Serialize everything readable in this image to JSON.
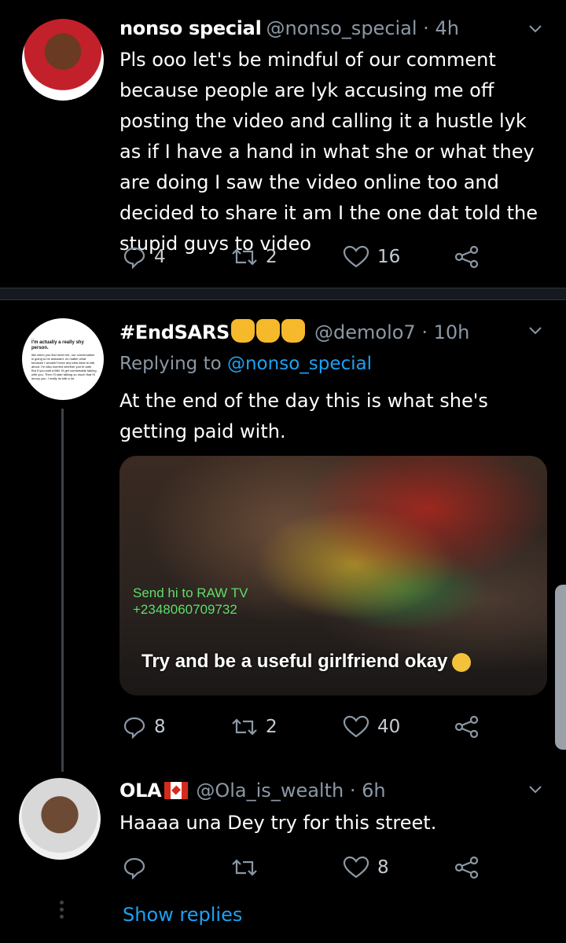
{
  "tweets": [
    {
      "name": "nonso special",
      "handle": "@nonso_special · 4h",
      "text": "Pls ooo let's be mindful of our comment because people are lyk accusing me off posting the video and calling it a hustle lyk as if I have a hand in what she or what they are doing I saw the video online too and decided to share it am I the one dat told the stupid guys to video",
      "replies": "4",
      "retweets": "2",
      "likes": "16"
    },
    {
      "name": "#EndSARS",
      "handle": "@demolo7 · 10h",
      "replying_prefix": "Replying to",
      "replying_to": "@nonso_special",
      "text": "At the end of the day this is what she's getting paid with.",
      "avatar_text": {
        "line1": "I'm actually a really shy person.",
        "line2": "like when you first meet me, our conversation is going to be awkward, no matter what because I wouldn't have any idea what to talk about. I'm also worried whether you're safe. But if you wait a little I'll get comfortable talking with you. Then I'll start talking so much that I'll annoy you. I really do talk a lot."
      },
      "media": {
        "watermark_line1": "Send hi to RAW TV",
        "watermark_line2": "+2348060709732",
        "caption": "Try and be a useful girlfriend okay"
      },
      "replies": "8",
      "retweets": "2",
      "likes": "40"
    },
    {
      "name": "OLA",
      "handle": "@Ola_is_wealth · 6h",
      "text": "Haaaa una Dey try for this street.",
      "replies": "",
      "retweets": "",
      "likes": "8"
    }
  ],
  "show_replies": "Show replies",
  "icons": [
    "reply-icon",
    "retweet-icon",
    "like-icon",
    "share-icon",
    "chevron-down-icon",
    "raised-fist-emoji",
    "canada-flag-emoji",
    "worried-face-emoji"
  ],
  "colors": {
    "background": "#000000",
    "muted": "#8b98a5",
    "link": "#1da1f2",
    "divider": "#151a20"
  }
}
